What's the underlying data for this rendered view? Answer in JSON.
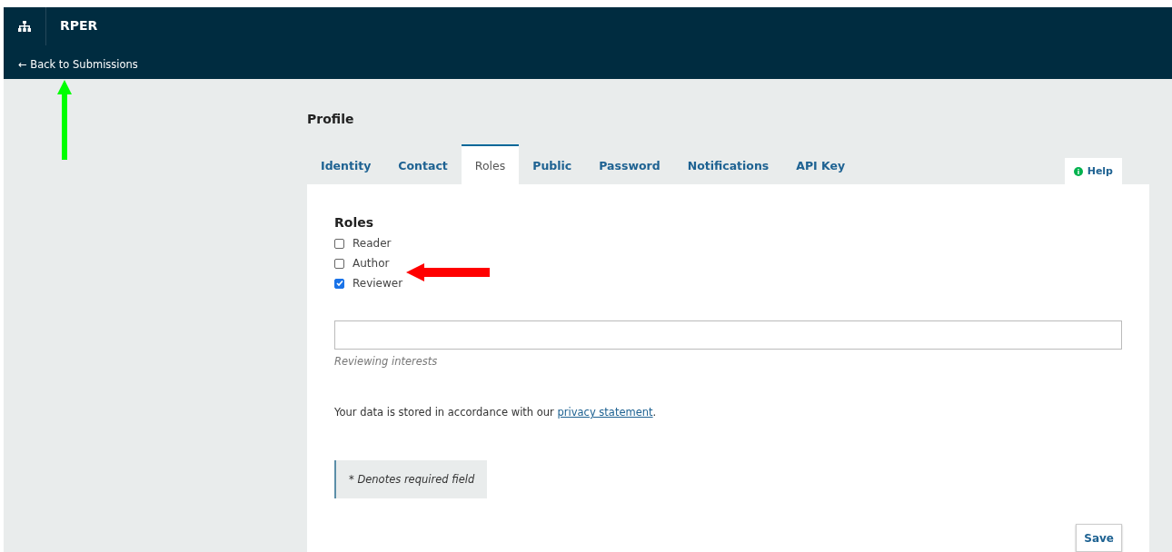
{
  "header": {
    "site_title": "RPER",
    "back_link": "← Back to Submissions"
  },
  "page_title": "Profile",
  "tabs": [
    {
      "label": "Identity",
      "selected": false
    },
    {
      "label": "Contact",
      "selected": false
    },
    {
      "label": "Roles",
      "selected": true
    },
    {
      "label": "Public",
      "selected": false
    },
    {
      "label": "Password",
      "selected": false
    },
    {
      "label": "Notifications",
      "selected": false
    },
    {
      "label": "API Key",
      "selected": false
    }
  ],
  "help_button": "Help",
  "roles": {
    "heading": "Roles",
    "options": [
      {
        "label": "Reader",
        "checked": false
      },
      {
        "label": "Author",
        "checked": false
      },
      {
        "label": "Reviewer",
        "checked": true
      }
    ]
  },
  "reviewing_interests": {
    "label": "Reviewing interests"
  },
  "privacy_note": {
    "text": "Your data is stored in accordance with our",
    "link": "privacy statement",
    "end": "."
  },
  "required_note": "* Denotes required field",
  "save_button": "Save"
}
